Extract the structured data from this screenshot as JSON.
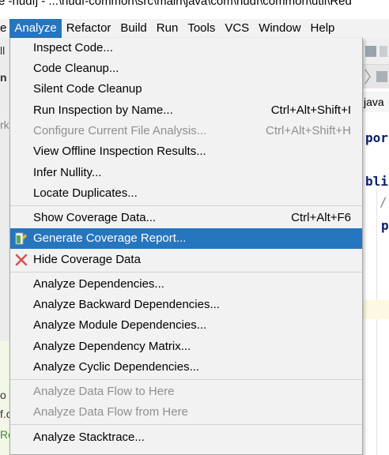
{
  "window": {
    "title": "e  -hudfj - ...\\hudf-common\\src\\main\\java\\com\\hudf\\common\\util\\Red"
  },
  "menubar": {
    "partial_first": "e",
    "items": [
      "Analyze",
      "Refactor",
      "Build",
      "Run",
      "Tools",
      "VCS",
      "Window",
      "Help"
    ],
    "active": "Analyze"
  },
  "editor": {
    "left_fragments": [
      "ll",
      "n",
      "rk",
      "o",
      "f.c",
      "Re"
    ],
    "tab_label": "java",
    "code_fragments": [
      "por",
      "bli",
      "/",
      "p"
    ]
  },
  "analyze_menu": {
    "groups": [
      [
        {
          "label": "Inspect Code...",
          "shortcut": "",
          "disabled": false
        },
        {
          "label": "Code Cleanup...",
          "shortcut": "",
          "disabled": false
        },
        {
          "label": "Silent Code Cleanup",
          "shortcut": "",
          "disabled": false
        },
        {
          "label": "Run Inspection by Name...",
          "shortcut": "Ctrl+Alt+Shift+I",
          "disabled": false
        },
        {
          "label": "Configure Current File Analysis...",
          "shortcut": "Ctrl+Alt+Shift+H",
          "disabled": true
        },
        {
          "label": "View Offline Inspection Results...",
          "shortcut": "",
          "disabled": false
        },
        {
          "label": "Infer Nullity...",
          "shortcut": "",
          "disabled": false
        },
        {
          "label": "Locate Duplicates...",
          "shortcut": "",
          "disabled": false
        }
      ],
      [
        {
          "label": "Show Coverage Data...",
          "shortcut": "Ctrl+Alt+F6",
          "disabled": false
        },
        {
          "label": "Generate Coverage Report...",
          "shortcut": "",
          "disabled": false,
          "selected": true,
          "icon": "coverage-report-icon"
        },
        {
          "label": "Hide Coverage Data",
          "shortcut": "",
          "disabled": false,
          "icon": "close-x-icon"
        }
      ],
      [
        {
          "label": "Analyze Dependencies...",
          "shortcut": "",
          "disabled": false
        },
        {
          "label": "Analyze Backward Dependencies...",
          "shortcut": "",
          "disabled": false
        },
        {
          "label": "Analyze Module Dependencies...",
          "shortcut": "",
          "disabled": false
        },
        {
          "label": "Analyze Dependency Matrix...",
          "shortcut": "",
          "disabled": false
        },
        {
          "label": "Analyze Cyclic Dependencies...",
          "shortcut": "",
          "disabled": false
        }
      ],
      [
        {
          "label": "Analyze Data Flow to Here",
          "shortcut": "",
          "disabled": true
        },
        {
          "label": "Analyze Data Flow from Here",
          "shortcut": "",
          "disabled": true
        }
      ],
      [
        {
          "label": "Analyze Stacktrace...",
          "shortcut": "",
          "disabled": false
        }
      ]
    ]
  },
  "colors": {
    "selection": "#2675bf",
    "menu_bg": "#f2f2f2",
    "disabled_text": "#8f8f8f",
    "close_icon": "#d9534f",
    "coverage_icon_green": "#4caf50"
  }
}
